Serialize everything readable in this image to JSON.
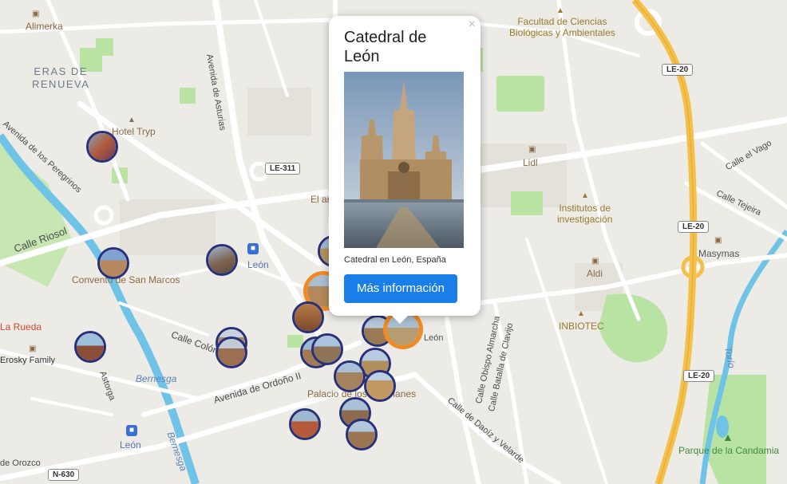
{
  "map": {
    "labels": {
      "alimerka": "Alimerka",
      "eras_de_renueva": "ERAS DE\nRENUEVA",
      "hotel_tryp": "Hotel Tryp",
      "avenida_de_asturias": "Avenida de Asturias",
      "avenida_de_los_peregrinos": "Avenida de los Peregrinos",
      "calle_riosol": "Calle Riosol",
      "convento_san_marcos": "Convento de San Marcos",
      "la_rueda": "La Rueda",
      "erosky_family": "Erosky Family",
      "astorga": "Astorga",
      "bernesga_1": "Bernesga",
      "bernesga_2": "Bernesga",
      "calle_colon": "Calle Colón",
      "avenida_de_ordono": "Avenida de Ordoño II",
      "palacio": "Palacio de los Guzmanes",
      "leon_train_1": "León",
      "leon_train_2": "León",
      "leon_center": "León",
      "el_ar": "El ar",
      "orozco": "de Orozco",
      "facultad": "Facultad de Ciencias\nBiológicas y Ambientales",
      "lidl": "Lidl",
      "institutos": "Institutos de\ninvestigación",
      "aldi": "Aldi",
      "inbiotec": "INBIOTEC",
      "masymas": "Masymas",
      "calle_el_vago": "Calle el Vago",
      "calle_tejeira": "Calle Tejeira",
      "torio": "Torío",
      "parque_candamia": "Parque de la Candamia",
      "calle_obispo": "Calle Obispo Almarcha",
      "calle_batalla": "Calle Batalla de Clavijo",
      "calle_daoiz": "Calle de Daoíz y Velarde"
    },
    "shields": {
      "le311": "LE-311",
      "le20_a": "LE-20",
      "le20_b": "LE-20",
      "le20_c": "LE-20",
      "n630": "N-630"
    },
    "colors": {
      "background": "#ecebe6",
      "park": "#b9e3a3",
      "road": "#ffffff",
      "highway": "#f5c04a",
      "river": "#6fc3e6",
      "marker_border": "#29307a",
      "marker_selected": "#f08a24",
      "button": "#1a7ee8"
    }
  },
  "popup": {
    "title": "Catedral de León",
    "caption": "Catedral en León, España",
    "button_label": "Más información",
    "close_glyph": "×"
  }
}
